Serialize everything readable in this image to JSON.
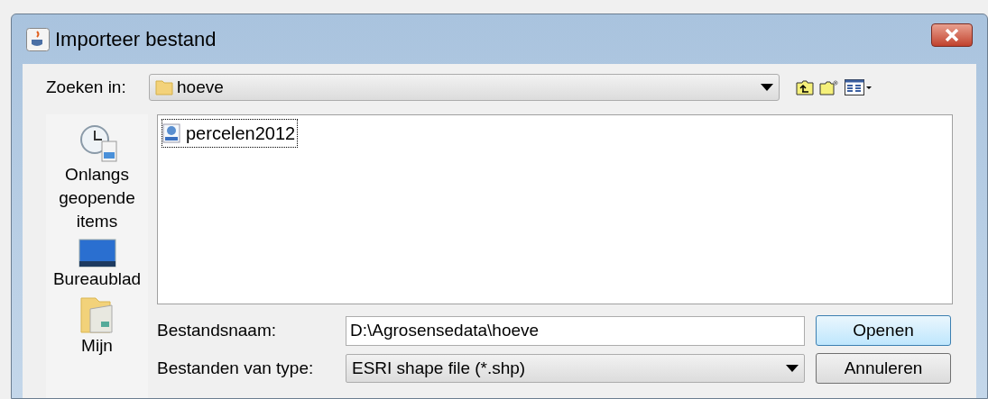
{
  "window": {
    "title": "Importeer bestand"
  },
  "look_in": {
    "label": "Zoeken in:",
    "value": "hoeve"
  },
  "places": [
    {
      "kind": "recent",
      "label": "Onlangs geopende items",
      "selected": false
    },
    {
      "kind": "desktop",
      "label": "Bureaublad",
      "selected": false
    },
    {
      "kind": "documents",
      "label": "Mijn",
      "selected": false
    }
  ],
  "files": [
    {
      "name": "percelen2012",
      "selected": true
    }
  ],
  "file_name": {
    "label": "Bestandsnaam:",
    "value": "D:\\Agrosensedata\\hoeve"
  },
  "file_type": {
    "label": "Bestanden van type:",
    "value": "ESRI shape file (*.shp)"
  },
  "buttons": [
    {
      "label": "Openen",
      "default": true
    },
    {
      "label": "Annuleren",
      "default": false
    }
  ]
}
